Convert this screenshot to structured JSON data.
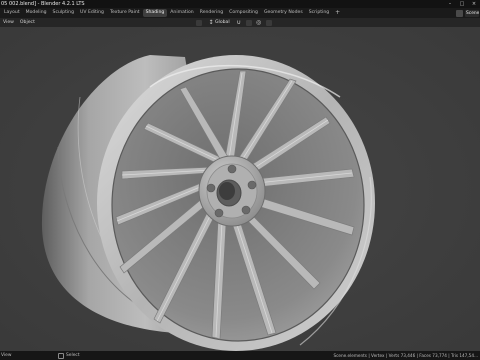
{
  "window": {
    "title": "05 002.blend] - Blender 4.2.1 LTS",
    "controls": [
      "–",
      "□",
      "×"
    ]
  },
  "workspace_tabs": [
    {
      "label": "Layout",
      "active": false
    },
    {
      "label": "Modeling",
      "active": false
    },
    {
      "label": "Sculpting",
      "active": false
    },
    {
      "label": "UV Editing",
      "active": false
    },
    {
      "label": "Texture Paint",
      "active": false
    },
    {
      "label": "Shading",
      "active": true
    },
    {
      "label": "Animation",
      "active": false
    },
    {
      "label": "Rendering",
      "active": false
    },
    {
      "label": "Compositing",
      "active": false
    },
    {
      "label": "Geometry Nodes",
      "active": false
    },
    {
      "label": "Scripting",
      "active": false
    }
  ],
  "add_workspace_label": "+",
  "scene": {
    "field_label": "Scene"
  },
  "viewport_header": {
    "view_label": "View",
    "object_label": "Object",
    "transform_orientation": "Global"
  },
  "status_bar": {
    "select_label": "Select",
    "stats": "Scene.elements | Vertex | Verts 73,446 | Faces 73,774 | Tris 147,54..."
  },
  "colors": {
    "viewport_bg": "#3f3f3f",
    "mesh_base": "#a8a8a8",
    "mesh_highlight": "#d2d2d2",
    "mesh_shadow": "#6a6a6a",
    "active_tab": "#3e3e3e"
  },
  "icons": {
    "scene": "scene-icon",
    "transform_orientation": "axes-icon",
    "snap": "magnet-icon",
    "proportional": "proportional-icon",
    "mouse": "mouse-left-icon"
  }
}
